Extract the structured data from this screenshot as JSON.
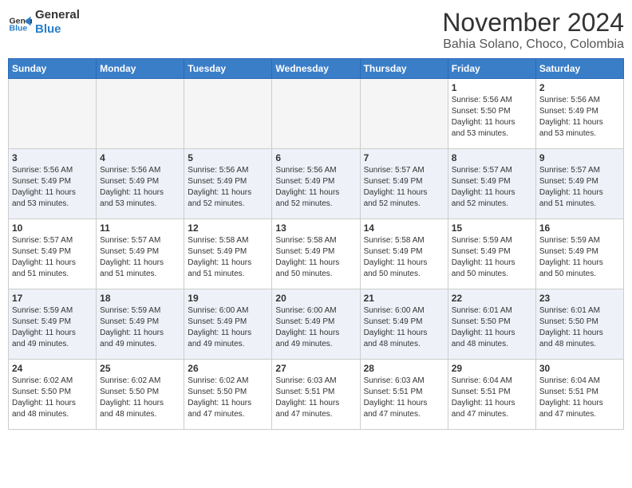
{
  "header": {
    "logo_line1": "General",
    "logo_line2": "Blue",
    "month": "November 2024",
    "location": "Bahia Solano, Choco, Colombia"
  },
  "weekdays": [
    "Sunday",
    "Monday",
    "Tuesday",
    "Wednesday",
    "Thursday",
    "Friday",
    "Saturday"
  ],
  "weeks": [
    [
      {
        "day": "",
        "info": ""
      },
      {
        "day": "",
        "info": ""
      },
      {
        "day": "",
        "info": ""
      },
      {
        "day": "",
        "info": ""
      },
      {
        "day": "",
        "info": ""
      },
      {
        "day": "1",
        "info": "Sunrise: 5:56 AM\nSunset: 5:50 PM\nDaylight: 11 hours\nand 53 minutes."
      },
      {
        "day": "2",
        "info": "Sunrise: 5:56 AM\nSunset: 5:49 PM\nDaylight: 11 hours\nand 53 minutes."
      }
    ],
    [
      {
        "day": "3",
        "info": "Sunrise: 5:56 AM\nSunset: 5:49 PM\nDaylight: 11 hours\nand 53 minutes."
      },
      {
        "day": "4",
        "info": "Sunrise: 5:56 AM\nSunset: 5:49 PM\nDaylight: 11 hours\nand 53 minutes."
      },
      {
        "day": "5",
        "info": "Sunrise: 5:56 AM\nSunset: 5:49 PM\nDaylight: 11 hours\nand 52 minutes."
      },
      {
        "day": "6",
        "info": "Sunrise: 5:56 AM\nSunset: 5:49 PM\nDaylight: 11 hours\nand 52 minutes."
      },
      {
        "day": "7",
        "info": "Sunrise: 5:57 AM\nSunset: 5:49 PM\nDaylight: 11 hours\nand 52 minutes."
      },
      {
        "day": "8",
        "info": "Sunrise: 5:57 AM\nSunset: 5:49 PM\nDaylight: 11 hours\nand 52 minutes."
      },
      {
        "day": "9",
        "info": "Sunrise: 5:57 AM\nSunset: 5:49 PM\nDaylight: 11 hours\nand 51 minutes."
      }
    ],
    [
      {
        "day": "10",
        "info": "Sunrise: 5:57 AM\nSunset: 5:49 PM\nDaylight: 11 hours\nand 51 minutes."
      },
      {
        "day": "11",
        "info": "Sunrise: 5:57 AM\nSunset: 5:49 PM\nDaylight: 11 hours\nand 51 minutes."
      },
      {
        "day": "12",
        "info": "Sunrise: 5:58 AM\nSunset: 5:49 PM\nDaylight: 11 hours\nand 51 minutes."
      },
      {
        "day": "13",
        "info": "Sunrise: 5:58 AM\nSunset: 5:49 PM\nDaylight: 11 hours\nand 50 minutes."
      },
      {
        "day": "14",
        "info": "Sunrise: 5:58 AM\nSunset: 5:49 PM\nDaylight: 11 hours\nand 50 minutes."
      },
      {
        "day": "15",
        "info": "Sunrise: 5:59 AM\nSunset: 5:49 PM\nDaylight: 11 hours\nand 50 minutes."
      },
      {
        "day": "16",
        "info": "Sunrise: 5:59 AM\nSunset: 5:49 PM\nDaylight: 11 hours\nand 50 minutes."
      }
    ],
    [
      {
        "day": "17",
        "info": "Sunrise: 5:59 AM\nSunset: 5:49 PM\nDaylight: 11 hours\nand 49 minutes."
      },
      {
        "day": "18",
        "info": "Sunrise: 5:59 AM\nSunset: 5:49 PM\nDaylight: 11 hours\nand 49 minutes."
      },
      {
        "day": "19",
        "info": "Sunrise: 6:00 AM\nSunset: 5:49 PM\nDaylight: 11 hours\nand 49 minutes."
      },
      {
        "day": "20",
        "info": "Sunrise: 6:00 AM\nSunset: 5:49 PM\nDaylight: 11 hours\nand 49 minutes."
      },
      {
        "day": "21",
        "info": "Sunrise: 6:00 AM\nSunset: 5:49 PM\nDaylight: 11 hours\nand 48 minutes."
      },
      {
        "day": "22",
        "info": "Sunrise: 6:01 AM\nSunset: 5:50 PM\nDaylight: 11 hours\nand 48 minutes."
      },
      {
        "day": "23",
        "info": "Sunrise: 6:01 AM\nSunset: 5:50 PM\nDaylight: 11 hours\nand 48 minutes."
      }
    ],
    [
      {
        "day": "24",
        "info": "Sunrise: 6:02 AM\nSunset: 5:50 PM\nDaylight: 11 hours\nand 48 minutes."
      },
      {
        "day": "25",
        "info": "Sunrise: 6:02 AM\nSunset: 5:50 PM\nDaylight: 11 hours\nand 48 minutes."
      },
      {
        "day": "26",
        "info": "Sunrise: 6:02 AM\nSunset: 5:50 PM\nDaylight: 11 hours\nand 47 minutes."
      },
      {
        "day": "27",
        "info": "Sunrise: 6:03 AM\nSunset: 5:51 PM\nDaylight: 11 hours\nand 47 minutes."
      },
      {
        "day": "28",
        "info": "Sunrise: 6:03 AM\nSunset: 5:51 PM\nDaylight: 11 hours\nand 47 minutes."
      },
      {
        "day": "29",
        "info": "Sunrise: 6:04 AM\nSunset: 5:51 PM\nDaylight: 11 hours\nand 47 minutes."
      },
      {
        "day": "30",
        "info": "Sunrise: 6:04 AM\nSunset: 5:51 PM\nDaylight: 11 hours\nand 47 minutes."
      }
    ]
  ]
}
